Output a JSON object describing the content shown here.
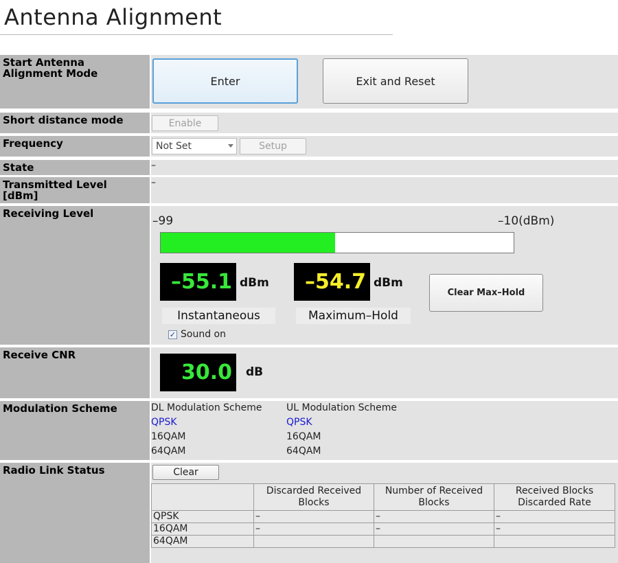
{
  "page": {
    "title": "Antenna Alignment"
  },
  "labels": {
    "start": "Start Antenna\nAlignment Mode",
    "short_distance": "Short distance mode",
    "frequency": "Frequency",
    "state": "State",
    "transmitted": "Transmitted Level\n[dBm]",
    "receiving": "Receiving Level",
    "cnr": "Receive CNR",
    "modulation": "Modulation Scheme",
    "radio_link": "Radio Link Status"
  },
  "start": {
    "enter_label": "Enter",
    "exit_label": "Exit and Reset"
  },
  "short_distance": {
    "enable_label": "Enable"
  },
  "frequency": {
    "selected": "Not Set",
    "setup_label": "Setup"
  },
  "state": {
    "value": "–"
  },
  "transmitted": {
    "value": "–"
  },
  "receiving": {
    "min_label": "–99",
    "max_label": "–10(dBm)",
    "bar_min": -99,
    "bar_max": -10,
    "bar_value": -55.1,
    "instantaneous_value": "–55.1",
    "instantaneous_unit": "dBm",
    "instantaneous_caption": "Instantaneous",
    "maxhold_value": "–54.7",
    "maxhold_unit": "dBm",
    "maxhold_caption": "Maximum–Hold",
    "clear_maxhold_label": "Clear Max–Hold",
    "sound_label": "Sound on",
    "sound_checked": true
  },
  "cnr": {
    "value": "30.0",
    "unit": "dB"
  },
  "modulation": {
    "dl_header": "DL Modulation Scheme",
    "ul_header": "UL Modulation Scheme",
    "dl_items": [
      "QPSK",
      "16QAM",
      "64QAM"
    ],
    "ul_items": [
      "QPSK",
      "16QAM",
      "64QAM"
    ]
  },
  "radio_link": {
    "clear_label": "Clear",
    "columns": [
      "",
      "Discarded Received\nBlocks",
      "Number of Received\nBlocks",
      "Received Blocks\nDiscarded Rate"
    ],
    "rows": [
      [
        "QPSK",
        "–",
        "–",
        "–"
      ],
      [
        "16QAM",
        "–",
        "–",
        "–"
      ],
      [
        "64QAM",
        "",
        "",
        ""
      ]
    ]
  },
  "colors": {
    "label_bg": "#b7b7b7",
    "value_bg": "#e3e3e3",
    "lcd_green": "#37e83a",
    "lcd_yellow": "#f5ee2a",
    "bar_fill": "#22ee22",
    "active_item": "#1a1ad0"
  }
}
